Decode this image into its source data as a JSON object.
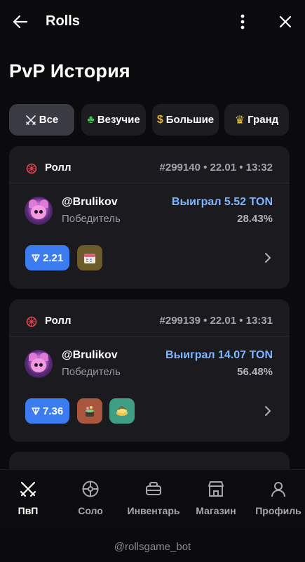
{
  "topbar": {
    "title": "Rolls"
  },
  "page": {
    "title": "PvP История"
  },
  "filters": [
    {
      "label": "Все",
      "icon": "crossed-swords-icon"
    },
    {
      "label": "Везучие",
      "icon": "four-leaf-clover-icon"
    },
    {
      "label": "Большие",
      "icon": "money-bag-icon"
    },
    {
      "label": "Гранд",
      "icon": "crown-icon"
    }
  ],
  "rolls": [
    {
      "type": "Ролл",
      "meta": "#299140 • 22.01 • 13:32",
      "user": "@Brulikov",
      "role": "Победитель",
      "result": "Выиграл 5.52 TON",
      "percent": "28.43%",
      "bet": "2.21",
      "gifts": [
        "calendar-gift-icon"
      ]
    },
    {
      "type": "Ролл",
      "meta": "#299139 • 22.01 • 13:31",
      "user": "@Brulikov",
      "role": "Победитель",
      "result": "Выиграл 14.07 TON",
      "percent": "56.48%",
      "bet": "7.36",
      "gifts": [
        "potion-gift-icon",
        "cake-gift-icon"
      ]
    }
  ],
  "nav": [
    {
      "label": "ПвП",
      "icon": "crossed-swords-icon"
    },
    {
      "label": "Соло",
      "icon": "wheel-icon"
    },
    {
      "label": "Инвентарь",
      "icon": "inventory-icon"
    },
    {
      "label": "Магазин",
      "icon": "store-icon"
    },
    {
      "label": "Профиль",
      "icon": "profile-icon"
    }
  ],
  "footer": "@rollsgame_bot",
  "colors": {
    "accent": "#3b7cf0",
    "win": "#7fb6ff",
    "card": "#1a1a1f",
    "background": "#0b0b0d"
  }
}
